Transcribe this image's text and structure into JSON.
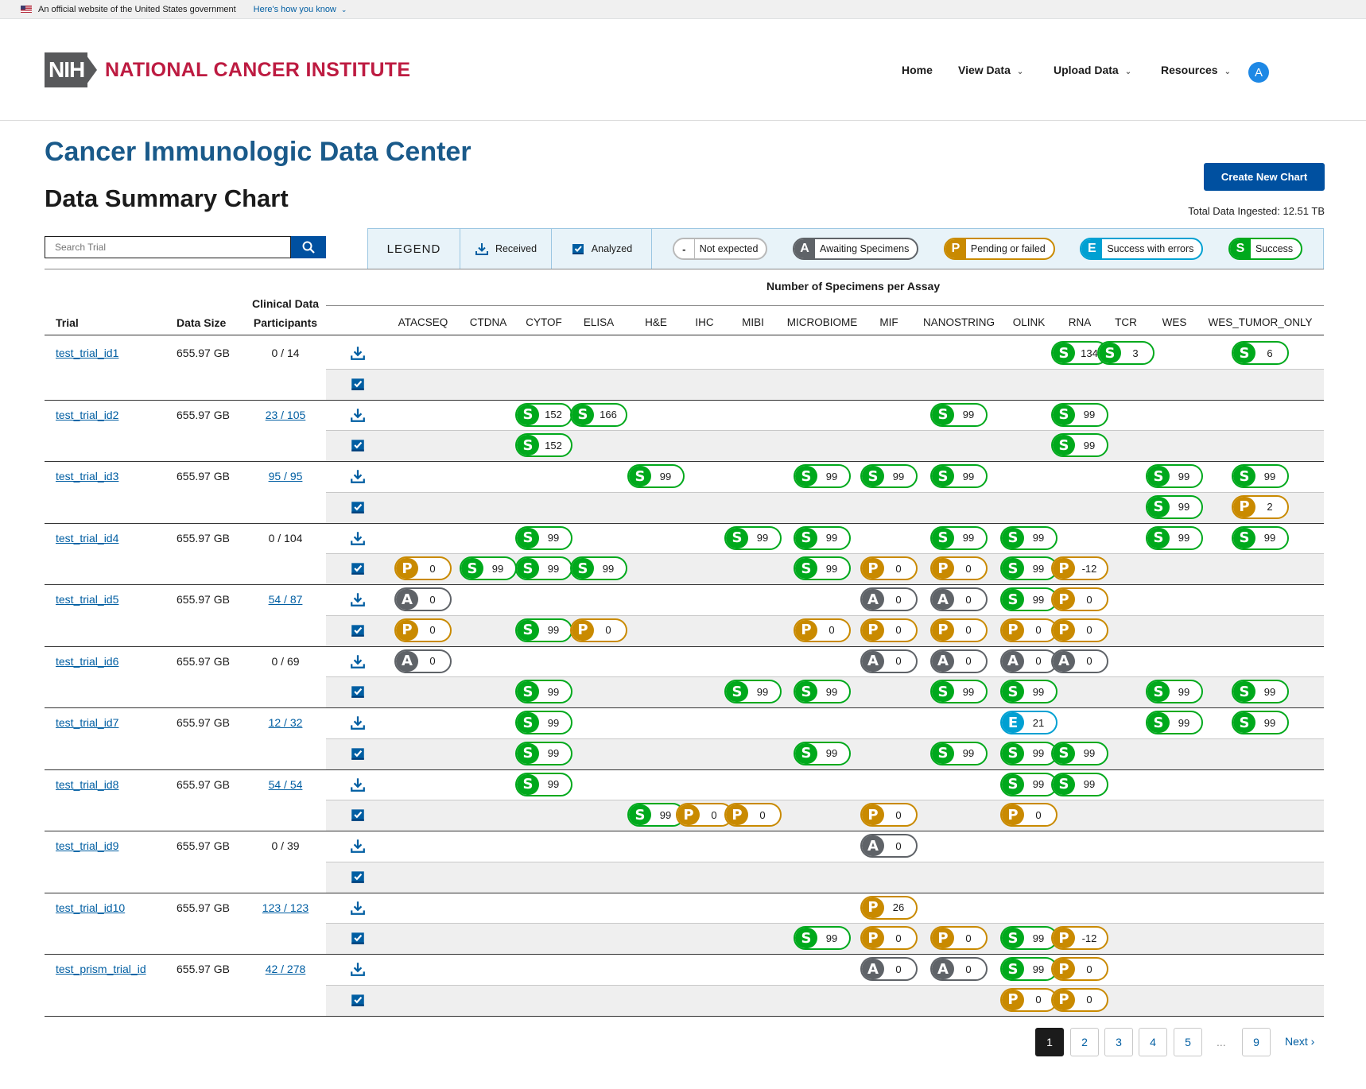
{
  "gov_banner": {
    "text": "An official website of the United States government",
    "link": "Here's how you know"
  },
  "header": {
    "logo_text": "NIH",
    "institute_name": "NATIONAL CANCER INSTITUTE",
    "nav": [
      {
        "label": "Home"
      },
      {
        "label": "View Data"
      },
      {
        "label": "Upload Data"
      },
      {
        "label": "Resources"
      }
    ],
    "avatar_initial": "A"
  },
  "page": {
    "site_title": "Cancer Immunologic Data Center",
    "title": "Data Summary Chart",
    "create_button": "Create New Chart",
    "total_ingested": "Total Data Ingested: 12.51 TB",
    "search_placeholder": "Search Trial"
  },
  "legend": {
    "title": "LEGEND",
    "received": "Received",
    "analyzed": "Analyzed",
    "not_expected_symbol": "-",
    "statuses": [
      {
        "letter": "",
        "label": "Not expected",
        "color": "#757575"
      },
      {
        "letter": "A",
        "label": "Awaiting Specimens",
        "color": "#5f6368"
      },
      {
        "letter": "P",
        "label": "Pending or failed",
        "color": "#c98a00"
      },
      {
        "letter": "E",
        "label": "Success with errors",
        "color": "#00a0d2"
      },
      {
        "letter": "S",
        "label": "Success",
        "color": "#00a91c"
      }
    ]
  },
  "table": {
    "assay_group_header": "Number of Specimens per Assay",
    "headers": {
      "trial": "Trial",
      "data_size": "Data Size",
      "participants_line1": "Clinical Data",
      "participants_line2": "Participants"
    },
    "assays": [
      "ATACSEQ",
      "CTDNA",
      "CYTOF",
      "ELISA",
      "H&E",
      "IHC",
      "MIBI",
      "MICROBIOME",
      "MIF",
      "NANOSTRING",
      "OLINK",
      "RNA",
      "TCR",
      "WES",
      "WES_TUMOR_ONLY"
    ],
    "trials": [
      {
        "name": "test_trial_id1",
        "size": "655.97 GB",
        "participants": "0 / 14",
        "participants_link": false,
        "received": [
          {
            "s": "S",
            "n": "134",
            "a": "RNA"
          },
          {
            "s": "S",
            "n": "3",
            "a": "TCR"
          },
          {
            "s": "S",
            "n": "6",
            "a": "WES_TUMOR_ONLY"
          }
        ],
        "analyzed": []
      },
      {
        "name": "test_trial_id2",
        "size": "655.97 GB",
        "participants": "23 / 105",
        "participants_link": true,
        "received": [
          {
            "s": "S",
            "n": "152",
            "a": "CYTOF"
          },
          {
            "s": "S",
            "n": "166",
            "a": "ELISA"
          },
          {
            "s": "S",
            "n": "99",
            "a": "NANOSTRING"
          },
          {
            "s": "S",
            "n": "99",
            "a": "RNA"
          }
        ],
        "analyzed": [
          {
            "s": "S",
            "n": "152",
            "a": "CYTOF"
          },
          {
            "s": "S",
            "n": "99",
            "a": "RNA"
          }
        ]
      },
      {
        "name": "test_trial_id3",
        "size": "655.97 GB",
        "participants": "95 / 95",
        "participants_link": true,
        "received": [
          {
            "s": "S",
            "n": "99",
            "a": "H&E"
          },
          {
            "s": "S",
            "n": "99",
            "a": "MICROBIOME"
          },
          {
            "s": "S",
            "n": "99",
            "a": "MIF"
          },
          {
            "s": "S",
            "n": "99",
            "a": "NANOSTRING"
          },
          {
            "s": "S",
            "n": "99",
            "a": "WES"
          },
          {
            "s": "S",
            "n": "99",
            "a": "WES_TUMOR_ONLY"
          }
        ],
        "analyzed": [
          {
            "s": "S",
            "n": "99",
            "a": "WES"
          },
          {
            "s": "P",
            "n": "2",
            "a": "WES_TUMOR_ONLY"
          }
        ]
      },
      {
        "name": "test_trial_id4",
        "size": "655.97 GB",
        "participants": "0 / 104",
        "participants_link": false,
        "received": [
          {
            "s": "S",
            "n": "99",
            "a": "CYTOF"
          },
          {
            "s": "S",
            "n": "99",
            "a": "MIBI"
          },
          {
            "s": "S",
            "n": "99",
            "a": "MICROBIOME"
          },
          {
            "s": "S",
            "n": "99",
            "a": "NANOSTRING"
          },
          {
            "s": "S",
            "n": "99",
            "a": "OLINK"
          },
          {
            "s": "S",
            "n": "99",
            "a": "WES"
          },
          {
            "s": "S",
            "n": "99",
            "a": "WES_TUMOR_ONLY"
          }
        ],
        "analyzed": [
          {
            "s": "P",
            "n": "0",
            "a": "ATACSEQ"
          },
          {
            "s": "S",
            "n": "99",
            "a": "CTDNA"
          },
          {
            "s": "S",
            "n": "99",
            "a": "CYTOF"
          },
          {
            "s": "S",
            "n": "99",
            "a": "ELISA"
          },
          {
            "s": "S",
            "n": "99",
            "a": "MICROBIOME"
          },
          {
            "s": "P",
            "n": "0",
            "a": "MIF"
          },
          {
            "s": "P",
            "n": "0",
            "a": "NANOSTRING"
          },
          {
            "s": "S",
            "n": "99",
            "a": "OLINK"
          },
          {
            "s": "P",
            "n": "-12",
            "a": "RNA"
          }
        ]
      },
      {
        "name": "test_trial_id5",
        "size": "655.97 GB",
        "participants": "54 / 87",
        "participants_link": true,
        "received": [
          {
            "s": "A",
            "n": "0",
            "a": "ATACSEQ"
          },
          {
            "s": "A",
            "n": "0",
            "a": "MIF"
          },
          {
            "s": "A",
            "n": "0",
            "a": "NANOSTRING"
          },
          {
            "s": "S",
            "n": "99",
            "a": "OLINK"
          },
          {
            "s": "P",
            "n": "0",
            "a": "RNA"
          }
        ],
        "analyzed": [
          {
            "s": "P",
            "n": "0",
            "a": "ATACSEQ"
          },
          {
            "s": "S",
            "n": "99",
            "a": "CYTOF"
          },
          {
            "s": "P",
            "n": "0",
            "a": "ELISA"
          },
          {
            "s": "P",
            "n": "0",
            "a": "MICROBIOME"
          },
          {
            "s": "P",
            "n": "0",
            "a": "MIF"
          },
          {
            "s": "P",
            "n": "0",
            "a": "NANOSTRING"
          },
          {
            "s": "P",
            "n": "0",
            "a": "OLINK"
          },
          {
            "s": "P",
            "n": "0",
            "a": "RNA"
          }
        ]
      },
      {
        "name": "test_trial_id6",
        "size": "655.97 GB",
        "participants": "0 / 69",
        "participants_link": false,
        "received": [
          {
            "s": "A",
            "n": "0",
            "a": "ATACSEQ"
          },
          {
            "s": "A",
            "n": "0",
            "a": "MIF"
          },
          {
            "s": "A",
            "n": "0",
            "a": "NANOSTRING"
          },
          {
            "s": "A",
            "n": "0",
            "a": "OLINK"
          },
          {
            "s": "A",
            "n": "0",
            "a": "RNA"
          }
        ],
        "analyzed": [
          {
            "s": "S",
            "n": "99",
            "a": "CYTOF"
          },
          {
            "s": "S",
            "n": "99",
            "a": "MIBI"
          },
          {
            "s": "S",
            "n": "99",
            "a": "MICROBIOME"
          },
          {
            "s": "S",
            "n": "99",
            "a": "NANOSTRING"
          },
          {
            "s": "S",
            "n": "99",
            "a": "OLINK"
          },
          {
            "s": "S",
            "n": "99",
            "a": "WES"
          },
          {
            "s": "S",
            "n": "99",
            "a": "WES_TUMOR_ONLY"
          }
        ]
      },
      {
        "name": "test_trial_id7",
        "size": "655.97 GB",
        "participants": "12 / 32",
        "participants_link": true,
        "received": [
          {
            "s": "S",
            "n": "99",
            "a": "CYTOF"
          },
          {
            "s": "E",
            "n": "21",
            "a": "OLINK"
          },
          {
            "s": "S",
            "n": "99",
            "a": "WES"
          },
          {
            "s": "S",
            "n": "99",
            "a": "WES_TUMOR_ONLY"
          }
        ],
        "analyzed": [
          {
            "s": "S",
            "n": "99",
            "a": "CYTOF"
          },
          {
            "s": "S",
            "n": "99",
            "a": "MICROBIOME"
          },
          {
            "s": "S",
            "n": "99",
            "a": "NANOSTRING"
          },
          {
            "s": "S",
            "n": "99",
            "a": "OLINK"
          },
          {
            "s": "S",
            "n": "99",
            "a": "RNA"
          }
        ]
      },
      {
        "name": "test_trial_id8",
        "size": "655.97 GB",
        "participants": "54 / 54",
        "participants_link": true,
        "received": [
          {
            "s": "S",
            "n": "99",
            "a": "CYTOF"
          },
          {
            "s": "S",
            "n": "99",
            "a": "OLINK"
          },
          {
            "s": "S",
            "n": "99",
            "a": "RNA"
          }
        ],
        "analyzed": [
          {
            "s": "S",
            "n": "99",
            "a": "H&E"
          },
          {
            "s": "P",
            "n": "0",
            "a": "IHC"
          },
          {
            "s": "P",
            "n": "0",
            "a": "MIBI"
          },
          {
            "s": "P",
            "n": "0",
            "a": "MIF"
          },
          {
            "s": "P",
            "n": "0",
            "a": "OLINK"
          }
        ]
      },
      {
        "name": "test_trial_id9",
        "size": "655.97 GB",
        "participants": "0 / 39",
        "participants_link": false,
        "received": [
          {
            "s": "A",
            "n": "0",
            "a": "MIF"
          }
        ],
        "analyzed": []
      },
      {
        "name": "test_trial_id10",
        "size": "655.97 GB",
        "participants": "123 / 123",
        "participants_link": true,
        "received": [
          {
            "s": "P",
            "n": "26",
            "a": "MIF"
          }
        ],
        "analyzed": [
          {
            "s": "S",
            "n": "99",
            "a": "MICROBIOME"
          },
          {
            "s": "P",
            "n": "0",
            "a": "MIF"
          },
          {
            "s": "P",
            "n": "0",
            "a": "NANOSTRING"
          },
          {
            "s": "S",
            "n": "99",
            "a": "OLINK"
          },
          {
            "s": "P",
            "n": "-12",
            "a": "RNA"
          }
        ]
      },
      {
        "name": "test_prism_trial_id",
        "size": "655.97 GB",
        "participants": "42 / 278",
        "participants_link": true,
        "received": [
          {
            "s": "A",
            "n": "0",
            "a": "MIF"
          },
          {
            "s": "A",
            "n": "0",
            "a": "NANOSTRING"
          },
          {
            "s": "S",
            "n": "99",
            "a": "OLINK"
          },
          {
            "s": "P",
            "n": "0",
            "a": "RNA"
          }
        ],
        "analyzed": [
          {
            "s": "P",
            "n": "0",
            "a": "OLINK"
          },
          {
            "s": "P",
            "n": "0",
            "a": "RNA"
          }
        ]
      }
    ]
  },
  "pagination": {
    "pages": [
      "1",
      "2",
      "3",
      "4",
      "5",
      "9"
    ],
    "current": "1",
    "ellipsis": "...",
    "next": "Next ›"
  }
}
